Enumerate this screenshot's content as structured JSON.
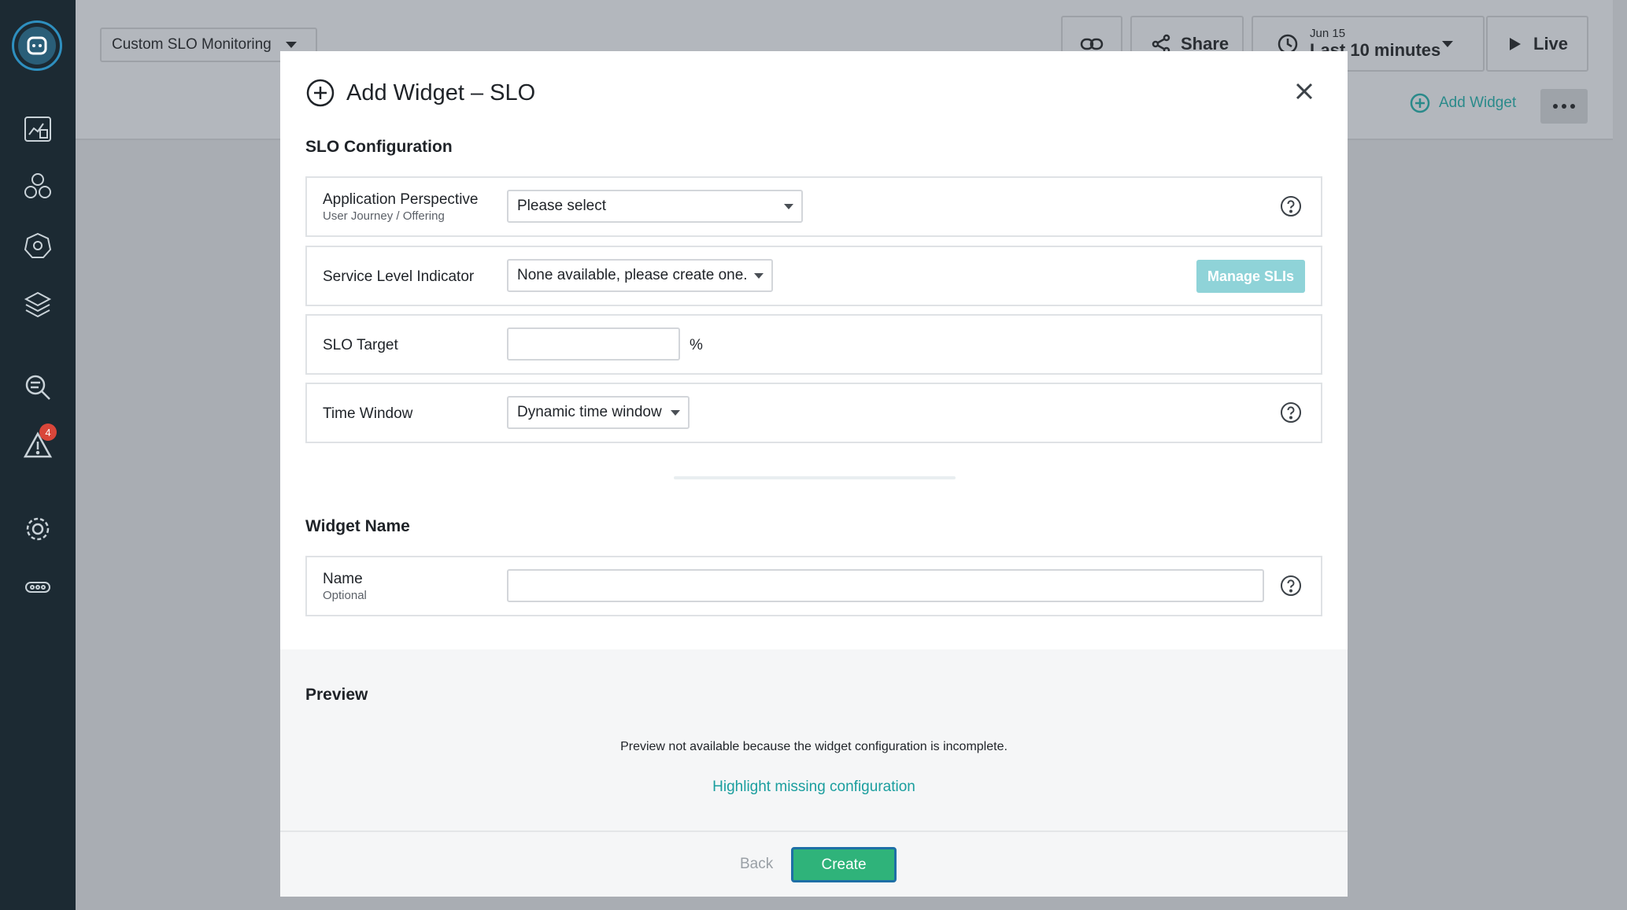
{
  "colors": {
    "accent": "#2fb37a",
    "link": "#1a9e9e",
    "sidebar": "#1c2a33",
    "badge": "#d9463a"
  },
  "sidebar": {
    "icons": [
      "logo-icon",
      "dashboard-icon",
      "applications-icon",
      "kubernetes-icon",
      "infrastructure-icon",
      "analytics-icon",
      "alerts-icon",
      "settings-icon",
      "more-icon"
    ],
    "alerts_badge": "4"
  },
  "topbar": {
    "dashboard_name": "Custom SLO Monitoring",
    "share_label": "Share",
    "time_date": "Jun 15",
    "time_range": "Last 10 minutes",
    "live_label": "Live",
    "add_widget_label": "Add Widget"
  },
  "modal": {
    "title": "Add Widget – SLO",
    "slo_section_title": "SLO Configuration",
    "app_perspective": {
      "label": "Application Perspective",
      "sublabel": "User Journey / Offering",
      "value": "Please select"
    },
    "sli": {
      "label": "Service Level Indicator",
      "value": "None available, please create one.",
      "manage_label": "Manage SLIs"
    },
    "slo_target": {
      "label": "SLO Target",
      "value": "",
      "unit": "%"
    },
    "time_window": {
      "label": "Time Window",
      "value": "Dynamic time window"
    },
    "widget_name_section_title": "Widget Name",
    "name": {
      "label": "Name",
      "sublabel": "Optional",
      "value": ""
    },
    "preview_title": "Preview",
    "preview_message": "Preview not available because the widget configuration is incomplete.",
    "highlight_link": "Highlight missing configuration",
    "back_label": "Back",
    "create_label": "Create"
  }
}
